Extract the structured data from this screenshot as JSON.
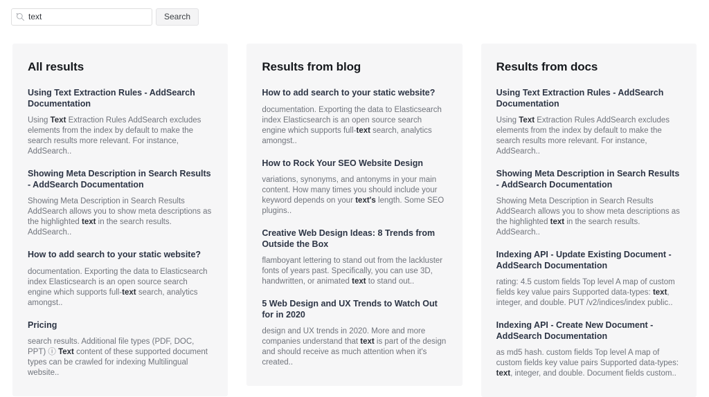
{
  "search": {
    "icon": "search-icon",
    "value": "text",
    "placeholder": "Search",
    "button_label": "Search"
  },
  "columns": [
    {
      "heading": "All results",
      "results": [
        {
          "title": "Using Text Extraction Rules - AddSearch Documentation",
          "snippet_parts": [
            {
              "text": "Using ",
              "bold": false
            },
            {
              "text": "Text",
              "bold": true
            },
            {
              "text": " Extraction Rules AddSearch excludes elements from the index by default to make the search results more relevant. For instance, AddSearch..",
              "bold": false
            }
          ]
        },
        {
          "title": "Showing Meta Description in Search Results - AddSearch Documentation",
          "snippet_parts": [
            {
              "text": "Showing Meta Description in Search Results AddSearch allows you to show meta descriptions as the highlighted ",
              "bold": false
            },
            {
              "text": "text",
              "bold": true
            },
            {
              "text": " in the search results. AddSearch..",
              "bold": false
            }
          ]
        },
        {
          "title": "How to add search to your static website?",
          "snippet_parts": [
            {
              "text": "documentation. Exporting the data to Elasticsearch index Elasticsearch is an open source search engine which supports full-",
              "bold": false
            },
            {
              "text": "text",
              "bold": true
            },
            {
              "text": " search, analytics amongst..",
              "bold": false
            }
          ]
        },
        {
          "title": "Pricing",
          "snippet_parts": [
            {
              "text": "search results. Additional file types (PDF, DOC, PPT) ⓘ ",
              "bold": false
            },
            {
              "text": "Text",
              "bold": true
            },
            {
              "text": " content of these supported document types can be crawled for indexing Multilingual website..",
              "bold": false
            }
          ]
        }
      ]
    },
    {
      "heading": "Results from blog",
      "results": [
        {
          "title": "How to add search to your static website?",
          "snippet_parts": [
            {
              "text": "documentation. Exporting the data to Elasticsearch index Elasticsearch is an open source search engine which supports full-",
              "bold": false
            },
            {
              "text": "text",
              "bold": true
            },
            {
              "text": " search, analytics amongst..",
              "bold": false
            }
          ]
        },
        {
          "title": "How to Rock Your SEO Website Design",
          "snippet_parts": [
            {
              "text": "variations, synonyms, and antonyms in your main content. How many times you should include your keyword depends on your ",
              "bold": false
            },
            {
              "text": "text's",
              "bold": true
            },
            {
              "text": " length. Some SEO plugins..",
              "bold": false
            }
          ]
        },
        {
          "title": "Creative Web Design Ideas: 8 Trends from Outside the Box",
          "snippet_parts": [
            {
              "text": "flamboyant lettering to stand out from the lackluster fonts of years past. Specifically, you can use 3D, handwritten, or animated ",
              "bold": false
            },
            {
              "text": "text",
              "bold": true
            },
            {
              "text": " to stand out..",
              "bold": false
            }
          ]
        },
        {
          "title": "5 Web Design and UX Trends to Watch Out for in 2020",
          "snippet_parts": [
            {
              "text": "design and UX trends in 2020. More and more companies understand that ",
              "bold": false
            },
            {
              "text": "text",
              "bold": true
            },
            {
              "text": " is part of the design and should receive as much attention when it's created..",
              "bold": false
            }
          ]
        }
      ]
    },
    {
      "heading": "Results from docs",
      "results": [
        {
          "title": "Using Text Extraction Rules - AddSearch Documentation",
          "snippet_parts": [
            {
              "text": "Using ",
              "bold": false
            },
            {
              "text": "Text",
              "bold": true
            },
            {
              "text": " Extraction Rules AddSearch excludes elements from the index by default to make the search results more relevant. For instance, AddSearch..",
              "bold": false
            }
          ]
        },
        {
          "title": "Showing Meta Description in Search Results - AddSearch Documentation",
          "snippet_parts": [
            {
              "text": "Showing Meta Description in Search Results AddSearch allows you to show meta descriptions as the highlighted ",
              "bold": false
            },
            {
              "text": "text",
              "bold": true
            },
            {
              "text": " in the search results. AddSearch..",
              "bold": false
            }
          ]
        },
        {
          "title": "Indexing API - Update Existing Document - AddSearch Documentation",
          "snippet_parts": [
            {
              "text": "rating: 4.5 custom fields Top level A map of custom fields key value pairs Supported data-types: ",
              "bold": false
            },
            {
              "text": "text",
              "bold": true
            },
            {
              "text": ", integer, and double. PUT /v2/indices/index public..",
              "bold": false
            }
          ]
        },
        {
          "title": "Indexing API - Create New Document - AddSearch Documentation",
          "snippet_parts": [
            {
              "text": "as md5 hash. custom fields Top level A map of custom fields key value pairs Supported data-types: ",
              "bold": false
            },
            {
              "text": "text",
              "bold": true
            },
            {
              "text": ", integer, and double. Document fields custom..",
              "bold": false
            }
          ]
        }
      ]
    }
  ],
  "colors": {
    "card_background": "#f6f6f7",
    "page_background": "#ffffff",
    "heading": "#15181c",
    "result_title": "#2d3545",
    "snippet": "#70747c",
    "highlight": "#2d3139"
  }
}
